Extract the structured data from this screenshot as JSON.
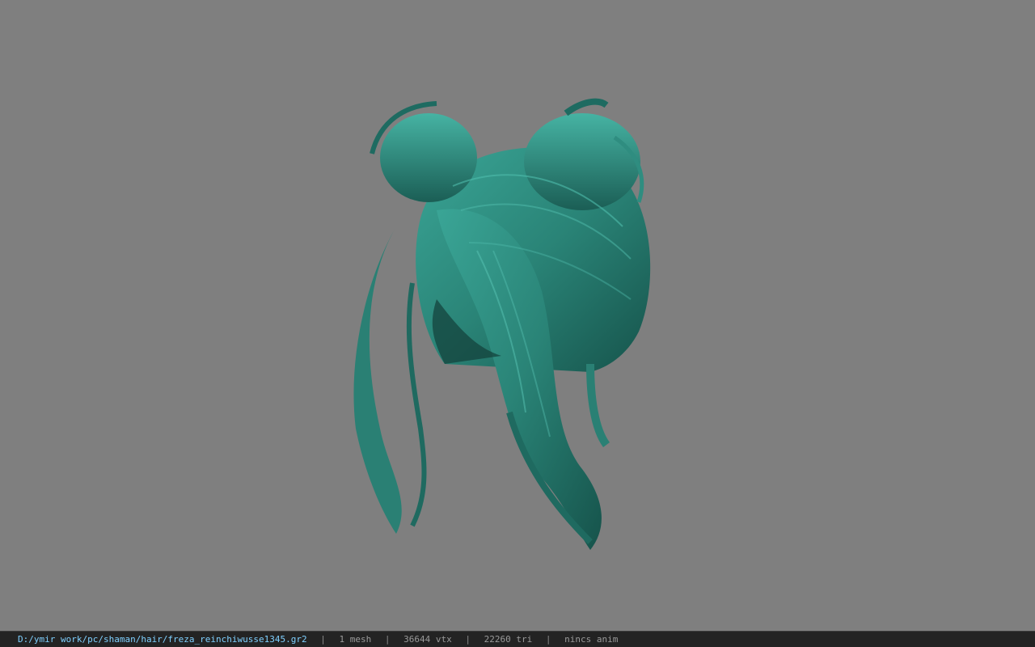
{
  "viewer": {
    "background_color": "#7f7f7f",
    "model_color": "#2f8a7e",
    "model_subject": "hair-mesh"
  },
  "status_bar": {
    "file_path": "D:/ymir work/pc/shaman/hair/freza_reinchiwusse1345.gr2",
    "separator": "|",
    "mesh_count": "1 mesh",
    "vertex_count": "36644 vtx",
    "triangle_count": "22260 tri",
    "anim_info": "nincs anim"
  }
}
